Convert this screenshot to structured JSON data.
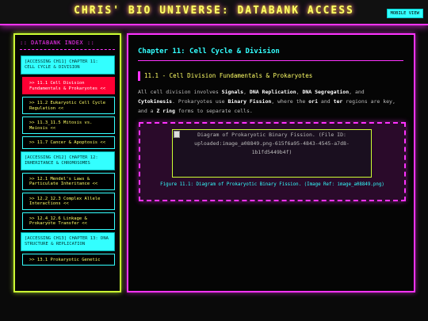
{
  "header": {
    "title": "CHRIS' BIO UNIVERSE: DATABANK ACCESS",
    "mobile_view_label": "MOBILE VIEW"
  },
  "sidebar": {
    "title": ":: DATABANK INDEX ::",
    "chapters": [
      {
        "label": "[ACCESSING CH11] CHAPTER 11: CELL CYCLE & DIVISION",
        "items": [
          {
            "label": ">> 11.1 Cell Division Fundamentals & Prokaryotes <<",
            "active": true
          },
          {
            "label": ">> 11.2 Eukaryotic Cell Cycle Regulation <<",
            "active": false
          },
          {
            "label": ">> 11.3_11.5 Mitosis vs. Meiosis <<",
            "active": false
          },
          {
            "label": ">> 11.7 Cancer & Apoptosis <<",
            "active": false
          }
        ]
      },
      {
        "label": "[ACCESSING CH12] CHAPTER 12: INHERITANCE & CHROMOSOMES",
        "items": [
          {
            "label": ">> 12.1 Mendel's Laws & Particulate Inheritance <<",
            "active": false
          },
          {
            "label": ">> 12.2_12.3 Complex Allele Interactions <<",
            "active": false
          },
          {
            "label": ">> 12.4_12.6 Linkage & Prokaryote Transfer <<",
            "active": false
          }
        ]
      },
      {
        "label": "[ACCESSING CH13] CHAPTER 13: DNA STRUCTURE & REPLICATION",
        "items": [
          {
            "label": ">> 13.1 Prokaryotic Genetic",
            "active": false
          }
        ]
      }
    ]
  },
  "main": {
    "chapter_title": "Chapter 11: Cell Cycle & Division",
    "section_title": "11.1 - Cell Division Fundamentals & Prokaryotes",
    "body": [
      {
        "text": "All cell division involves ",
        "bold": false
      },
      {
        "text": "Signals",
        "bold": true
      },
      {
        "text": ", ",
        "bold": false
      },
      {
        "text": "DNA Replication",
        "bold": true
      },
      {
        "text": ", ",
        "bold": false
      },
      {
        "text": "DNA Segregation",
        "bold": true
      },
      {
        "text": ", and ",
        "bold": false
      },
      {
        "text": "Cytokinesis",
        "bold": true
      },
      {
        "text": ". Prokaryotes use ",
        "bold": false
      },
      {
        "text": "Binary Fission",
        "bold": true
      },
      {
        "text": ", where the ",
        "bold": false
      },
      {
        "text": "ori",
        "bold": true
      },
      {
        "text": " and ",
        "bold": false
      },
      {
        "text": "ter",
        "bold": true
      },
      {
        "text": " regions are key, and a ",
        "bold": false
      },
      {
        "text": "Z ring",
        "bold": true
      },
      {
        "text": " forms to separate cells.",
        "bold": false
      }
    ],
    "figure": {
      "image_alt": "Diagram of Prokaryotic Binary Fission. (File ID: uploaded:image_a08849.png-615f6a95-4843-4545-a7d8-1b1fd5449b4f)",
      "caption": "Figure 11.1: Diagram of Prokaryotic Binary Fission. (Image Ref: image_a08849.png)"
    }
  },
  "colors": {
    "magenta": "#ff33ff",
    "cyan": "#33ffff",
    "yellow": "#ffff66",
    "lime": "#ccff33",
    "active_red": "#ff0033"
  }
}
